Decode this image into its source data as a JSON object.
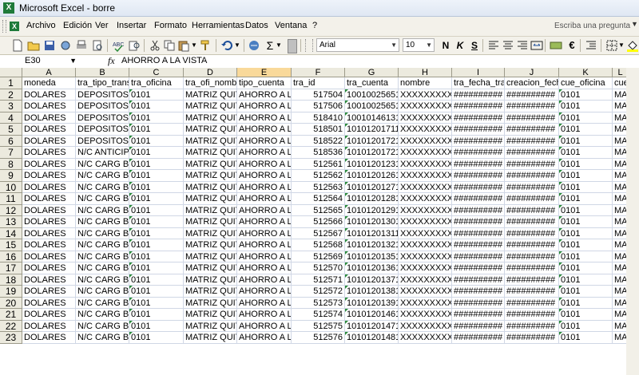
{
  "window": {
    "title": "Microsoft Excel - borre"
  },
  "menu": [
    {
      "name": "archivo",
      "label": "Archivo"
    },
    {
      "name": "edicion",
      "label": "Edición"
    },
    {
      "name": "ver",
      "label": "Ver"
    },
    {
      "name": "insertar",
      "label": "Insertar"
    },
    {
      "name": "formato",
      "label": "Formato"
    },
    {
      "name": "herramientas",
      "label": "Herramientas"
    },
    {
      "name": "datos",
      "label": "Datos"
    },
    {
      "name": "ventana",
      "label": "Ventana"
    },
    {
      "name": "ayuda",
      "label": "?"
    }
  ],
  "help": {
    "placeholder": "Escriba una pregunta"
  },
  "toolbar": {
    "font_name": "Arial",
    "font_size": "10",
    "bold": "N",
    "italic": "K",
    "underline": "S",
    "currency": "€",
    "sum": "Σ"
  },
  "formula_bar": {
    "cell_ref": "E30",
    "fx": "fx",
    "content": "AHORRO A LA VISTA"
  },
  "grid": {
    "columns": [
      "A",
      "B",
      "C",
      "D",
      "E",
      "F",
      "G",
      "H",
      "I",
      "J",
      "K",
      "L"
    ],
    "active_column": "E",
    "rows": [
      [
        "moneda",
        "tra_tipo_trans",
        "tra_oficina",
        "tra_ofi_nombr",
        "tipo_cuenta",
        "tra_id",
        "tra_cuenta",
        "nombre",
        "tra_fecha_tra",
        "creacion_fech",
        "cue_oficina",
        "cue_o"
      ],
      [
        "DOLARES",
        "DEPOSITOS C",
        "0101",
        "MATRIZ QUIT",
        "AHORRO A L",
        "517504",
        "10010025651",
        "XXXXXXXXXXX",
        "##########",
        "##########",
        "0101",
        "MATR"
      ],
      [
        "DOLARES",
        "DEPOSITOS C",
        "0101",
        "MATRIZ QUIT",
        "AHORRO A L",
        "517506",
        "10010025651",
        "XXXXXXXXXXX",
        "##########",
        "##########",
        "0101",
        "MATR"
      ],
      [
        "DOLARES",
        "DEPOSITOS C",
        "0101",
        "MATRIZ QUIT",
        "AHORRO A L",
        "518410",
        "10010146131",
        "XXXXXXXXXXX",
        "##########",
        "##########",
        "0101",
        "MATR"
      ],
      [
        "DOLARES",
        "DEPOSITOS C",
        "0101",
        "MATRIZ QUIT",
        "AHORRO A L",
        "518501",
        "10101201711",
        "XXXXXXXXXXX",
        "##########",
        "##########",
        "0101",
        "MATR"
      ],
      [
        "DOLARES",
        "DEPOSITOS C",
        "0101",
        "MATRIZ QUIT",
        "AHORRO A L",
        "518522",
        "10101201721",
        "XXXXXXXXXXX",
        "##########",
        "##########",
        "0101",
        "MATR"
      ],
      [
        "DOLARES",
        "N/C ANTICIP",
        "0101",
        "MATRIZ QUIT",
        "AHORRO A L",
        "518536",
        "10101201721",
        "XXXXXXXXXXX",
        "##########",
        "##########",
        "0101",
        "MATR"
      ],
      [
        "DOLARES",
        "N/C CARG B",
        "0101",
        "MATRIZ QUIT",
        "AHORRO A L",
        "512561",
        "10101201231",
        "XXXXXXXXXXX",
        "##########",
        "##########",
        "0101",
        "MATR"
      ],
      [
        "DOLARES",
        "N/C CARG B",
        "0101",
        "MATRIZ QUIT",
        "AHORRO A L",
        "512562",
        "10101201261",
        "XXXXXXXXXXX",
        "##########",
        "##########",
        "0101",
        "MATR"
      ],
      [
        "DOLARES",
        "N/C CARG B",
        "0101",
        "MATRIZ QUIT",
        "AHORRO A L",
        "512563",
        "10101201271",
        "XXXXXXXXXXX",
        "##########",
        "##########",
        "0101",
        "MATR"
      ],
      [
        "DOLARES",
        "N/C CARG B",
        "0101",
        "MATRIZ QUIT",
        "AHORRO A L",
        "512564",
        "10101201281",
        "XXXXXXXXXXX",
        "##########",
        "##########",
        "0101",
        "MATR"
      ],
      [
        "DOLARES",
        "N/C CARG B",
        "0101",
        "MATRIZ QUIT",
        "AHORRO A L",
        "512565",
        "10101201291",
        "XXXXXXXXXXX",
        "##########",
        "##########",
        "0101",
        "MATR"
      ],
      [
        "DOLARES",
        "N/C CARG B",
        "0101",
        "MATRIZ QUIT",
        "AHORRO A L",
        "512566",
        "10101201301",
        "XXXXXXXXXXX",
        "##########",
        "##########",
        "0101",
        "MATR"
      ],
      [
        "DOLARES",
        "N/C CARG B",
        "0101",
        "MATRIZ QUIT",
        "AHORRO A L",
        "512567",
        "10101201311",
        "XXXXXXXXXXX",
        "##########",
        "##########",
        "0101",
        "MATR"
      ],
      [
        "DOLARES",
        "N/C CARG B",
        "0101",
        "MATRIZ QUIT",
        "AHORRO A L",
        "512568",
        "10101201321",
        "XXXXXXXXXXX",
        "##########",
        "##########",
        "0101",
        "MATR"
      ],
      [
        "DOLARES",
        "N/C CARG B",
        "0101",
        "MATRIZ QUIT",
        "AHORRO A L",
        "512569",
        "10101201351",
        "XXXXXXXXXXX",
        "##########",
        "##########",
        "0101",
        "MATR"
      ],
      [
        "DOLARES",
        "N/C CARG B",
        "0101",
        "MATRIZ QUIT",
        "AHORRO A L",
        "512570",
        "10101201361",
        "XXXXXXXXXXX",
        "##########",
        "##########",
        "0101",
        "MATR"
      ],
      [
        "DOLARES",
        "N/C CARG B",
        "0101",
        "MATRIZ QUIT",
        "AHORRO A L",
        "512571",
        "10101201371",
        "XXXXXXXXXXX",
        "##########",
        "##########",
        "0101",
        "MATR"
      ],
      [
        "DOLARES",
        "N/C CARG B",
        "0101",
        "MATRIZ QUIT",
        "AHORRO A L",
        "512572",
        "10101201381",
        "XXXXXXXXXXX",
        "##########",
        "##########",
        "0101",
        "MATR"
      ],
      [
        "DOLARES",
        "N/C CARG B",
        "0101",
        "MATRIZ QUIT",
        "AHORRO A L",
        "512573",
        "10101201391",
        "XXXXXXXXXXX",
        "##########",
        "##########",
        "0101",
        "MATR"
      ],
      [
        "DOLARES",
        "N/C CARG B",
        "0101",
        "MATRIZ QUIT",
        "AHORRO A L",
        "512574",
        "10101201461",
        "XXXXXXXXXXX",
        "##########",
        "##########",
        "0101",
        "MATR"
      ],
      [
        "DOLARES",
        "N/C CARG B",
        "0101",
        "MATRIZ QUIT",
        "AHORRO A L",
        "512575",
        "10101201471",
        "XXXXXXXXXXX",
        "##########",
        "##########",
        "0101",
        "MATR"
      ],
      [
        "DOLARES",
        "N/C CARG B",
        "0101",
        "MATRIZ QUIT",
        "AHORRO A L",
        "512576",
        "10101201481",
        "XXXXXXXXXXX",
        "##########",
        "##########",
        "0101",
        "MATR"
      ]
    ]
  },
  "colors": {
    "active_header": "#f9d99a",
    "header_bg": "#eceade",
    "gridline": "#d0d7e5"
  }
}
